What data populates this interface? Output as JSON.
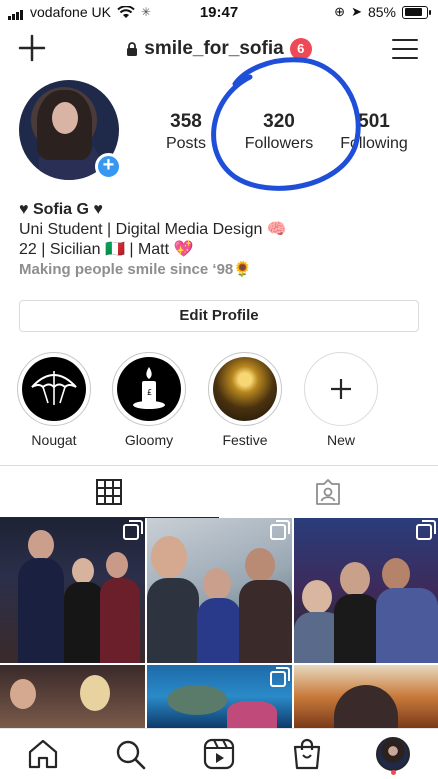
{
  "status_bar": {
    "carrier": "vodafone UK",
    "time": "19:47",
    "battery": "85%",
    "battery_level": 0.85
  },
  "header": {
    "username": "smile_for_sofia",
    "notification_count": "6"
  },
  "profile": {
    "stats": [
      {
        "value": "358",
        "label": "Posts"
      },
      {
        "value": "320",
        "label": "Followers"
      },
      {
        "value": "501",
        "label": "Following"
      }
    ],
    "name": "♥ Sofia G ♥",
    "bio_line1": "Uni Student | Digital Media Design 🧠",
    "bio_line2": "22 | Sicilian 🇮🇹 | Matt 💖",
    "bio_line3": "Making people smile since ‘98🌻",
    "edit_button": "Edit Profile"
  },
  "highlights": [
    {
      "label": "Nougat"
    },
    {
      "label": "Gloomy"
    },
    {
      "label": "Festive"
    },
    {
      "label": "New"
    }
  ],
  "tabs": [
    {
      "icon": "grid-icon",
      "active": true
    },
    {
      "icon": "tagged-icon",
      "active": false
    }
  ],
  "bottom_nav": [
    {
      "icon": "home-icon"
    },
    {
      "icon": "search-icon"
    },
    {
      "icon": "reels-icon"
    },
    {
      "icon": "shop-icon"
    },
    {
      "icon": "profile-avatar"
    }
  ],
  "colors": {
    "accent_blue": "#3897f0",
    "badge_red": "#ed4956",
    "scribble_blue": "#1f4fd8"
  }
}
